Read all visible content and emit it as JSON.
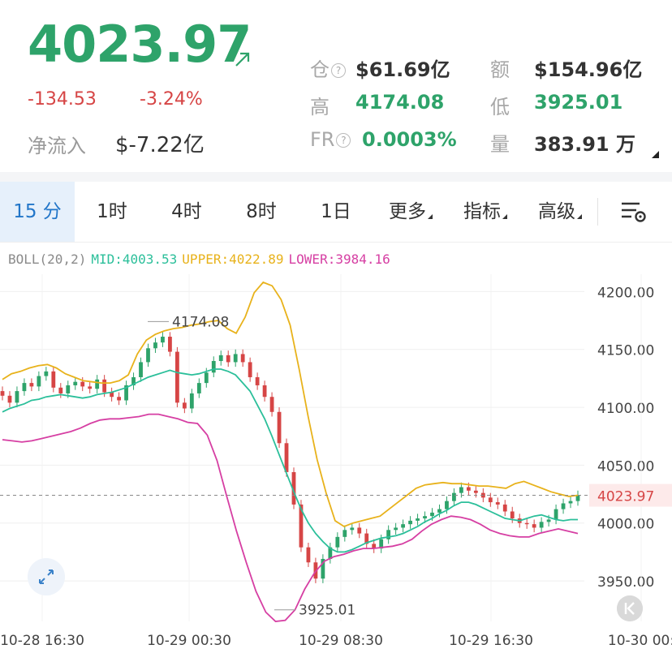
{
  "ticker": {
    "price": "4023.97",
    "change": "-134.53",
    "change_pct": "-3.24%",
    "netflow_label": "净流入",
    "netflow_value": "$-7.22亿",
    "open_interest_label": "仓",
    "open_interest_value": "$61.69亿",
    "turnover_label": "额",
    "turnover_value": "$154.96亿",
    "high_label": "高",
    "high_value": "4174.08",
    "low_label": "低",
    "low_value": "3925.01",
    "fr_label": "FR",
    "fr_value": "0.0003%",
    "volume_label": "量",
    "volume_value": "383.91 万",
    "help_glyph": "?"
  },
  "tabs": [
    {
      "label": "15 分",
      "active": true
    },
    {
      "label": "1时"
    },
    {
      "label": "4时"
    },
    {
      "label": "8时"
    },
    {
      "label": "1日"
    },
    {
      "label": "更多",
      "caret": true
    },
    {
      "label": "指标",
      "caret": true
    },
    {
      "label": "高级",
      "caret": true
    }
  ],
  "indicator": {
    "name": "BOLL(20,2)",
    "mid": "MID:4003.53",
    "upper": "UPPER:4022.89",
    "lower": "LOWER:3984.16"
  },
  "colors": {
    "up": "#2ea36a",
    "down": "#d64545",
    "mid": "#2bbf9a",
    "upper": "#e8b21b",
    "lower": "#d63fa3",
    "accent": "#2276c9"
  },
  "icons": {
    "trend": "arrow-up-right-icon",
    "settings": "chart-settings-icon",
    "expand": "expand-icon",
    "jump_latest": "jump-to-latest-icon"
  },
  "chart_data": {
    "type": "candlestick",
    "x_ticks": [
      "10-28 16:30",
      "10-29 00:30",
      "10-29 08:30",
      "10-29 16:30",
      "10-30 00:"
    ],
    "y_ticks": [
      4200,
      4150,
      4100,
      4050,
      4000,
      3950
    ],
    "y_tick_labels": [
      "4200.00",
      "4150.00",
      "4100.00",
      "4050.00",
      "4000.00",
      "3950.00"
    ],
    "ylim": [
      3915,
      4215
    ],
    "last_price": 4023.97,
    "last_price_label": "4023.97",
    "high_marker": {
      "value": 4174.08,
      "label": "4174.08"
    },
    "low_marker": {
      "value": 3925.01,
      "label": "3925.01"
    },
    "closes": [
      4110,
      4104,
      4114,
      4121,
      4118,
      4127,
      4131,
      4117,
      4112,
      4119,
      4122,
      4118,
      4116,
      4124,
      4113,
      4109,
      4106,
      4119,
      4126,
      4139,
      4151,
      4156,
      4161,
      4148,
      4104,
      4099,
      4112,
      4121,
      4130,
      4140,
      4145,
      4139,
      4146,
      4139,
      4126,
      4119,
      4109,
      4096,
      4069,
      4044,
      4016,
      3979,
      3966,
      3952,
      3969,
      3979,
      3988,
      3994,
      3996,
      3991,
      3982,
      3978,
      3986,
      3994,
      3996,
      3999,
      4002,
      4004,
      4006,
      4009,
      4012,
      4019,
      4026,
      4031,
      4028,
      4026,
      4022,
      4018,
      4016,
      4010,
      4004,
      4000,
      3999,
      3996,
      4001,
      4003,
      4012,
      4017,
      4019,
      4024
    ],
    "mid_band": [
      4096,
      4099,
      4101,
      4103,
      4106,
      4107,
      4109,
      4110,
      4111,
      4110,
      4109,
      4108,
      4109,
      4111,
      4112,
      4113,
      4115,
      4117,
      4120,
      4123,
      4126,
      4128,
      4130,
      4132,
      4130,
      4129,
      4128,
      4129,
      4131,
      4133,
      4133,
      4131,
      4128,
      4121,
      4114,
      4102,
      4090,
      4075,
      4059,
      4043,
      4027,
      4012,
      4000,
      3991,
      3984,
      3978,
      3975,
      3975,
      3977,
      3980,
      3983,
      3985,
      3987,
      3988,
      3989,
      3991,
      3994,
      3997,
      4001,
      4004,
      4008,
      4011,
      4015,
      4018,
      4018,
      4016,
      4013,
      4010,
      4007,
      4004,
      4003,
      4002,
      4004,
      4006,
      4007,
      4005,
      4003,
      4002,
      4003,
      4003
    ],
    "upper_band": [
      4124,
      4129,
      4131,
      4134,
      4136,
      4137,
      4134,
      4129,
      4126,
      4123,
      4122,
      4121,
      4121,
      4123,
      4128,
      4146,
      4158,
      4163,
      4166,
      4168,
      4169,
      4171,
      4172,
      4174,
      4175,
      4168,
      4164,
      4178,
      4199,
      4208,
      4205,
      4193,
      4171,
      4133,
      4092,
      4055,
      4026,
      4002,
      3997,
      4000,
      4002,
      4004,
      4006,
      4012,
      4018,
      4024,
      4030,
      4033,
      4034,
      4035,
      4034,
      4034,
      4033,
      4032,
      4032,
      4031,
      4030,
      4034,
      4036,
      4033,
      4030,
      4027,
      4025,
      4023,
      4024
    ],
    "lower_band": [
      4072,
      4071,
      4070,
      4071,
      4073,
      4075,
      4077,
      4079,
      4082,
      4086,
      4089,
      4090,
      4090,
      4091,
      4092,
      4094,
      4094,
      4092,
      4090,
      4087,
      4086,
      4076,
      4054,
      4023,
      3993,
      3966,
      3941,
      3923,
      3915,
      3916,
      3925,
      3943,
      3957,
      3967,
      3971,
      3973,
      3976,
      3978,
      3978,
      3979,
      3980,
      3982,
      3986,
      3993,
      3999,
      4003,
      4006,
      4005,
      4003,
      3999,
      3994,
      3991,
      3989,
      3988,
      3988,
      3991,
      3993,
      3995,
      3993,
      3991
    ]
  }
}
